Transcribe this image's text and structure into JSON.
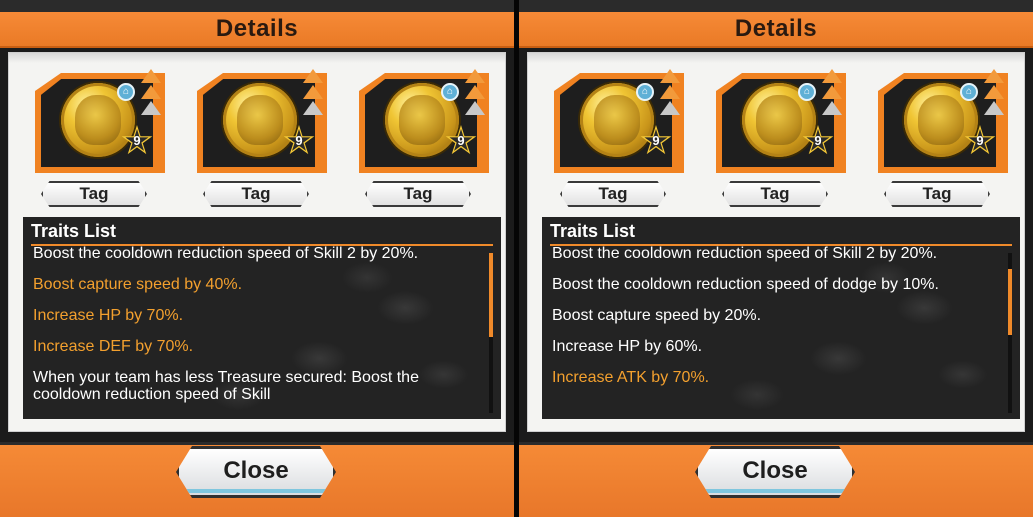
{
  "panels": [
    {
      "title": "Details",
      "cards": [
        {
          "tag": "Tag",
          "star": "9"
        },
        {
          "tag": "Tag",
          "star": "9"
        },
        {
          "tag": "Tag",
          "star": "9"
        }
      ],
      "traits_title": "Traits List",
      "traits": [
        {
          "text": "Boost the cooldown reduction speed of Skill 2 by 20%.",
          "color": "white"
        },
        {
          "text": "Boost capture speed by 40%.",
          "color": "orange"
        },
        {
          "text": "Increase HP by 70%.",
          "color": "orange"
        },
        {
          "text": "Increase DEF by 70%.",
          "color": "orange"
        },
        {
          "text": "When your team has less Treasure secured: Boost the cooldown reduction speed of Skill",
          "color": "white"
        }
      ],
      "close_label": "Close"
    },
    {
      "title": "Details",
      "cards": [
        {
          "tag": "Tag",
          "star": "9"
        },
        {
          "tag": "Tag",
          "star": "9"
        },
        {
          "tag": "Tag",
          "star": "9"
        }
      ],
      "traits_title": "Traits List",
      "traits": [
        {
          "text": "Boost the cooldown reduction speed of Skill 2 by 20%.",
          "color": "white"
        },
        {
          "text": "Boost the cooldown reduction speed of dodge by 10%.",
          "color": "white"
        },
        {
          "text": "Boost capture speed by 20%.",
          "color": "white"
        },
        {
          "text": "Increase HP by 60%.",
          "color": "white"
        },
        {
          "text": "Increase ATK by 70%.",
          "color": "orange"
        }
      ],
      "close_label": "Close"
    }
  ],
  "colors": {
    "accent": "#f08a2a",
    "orange_text": "#f3a02e"
  }
}
